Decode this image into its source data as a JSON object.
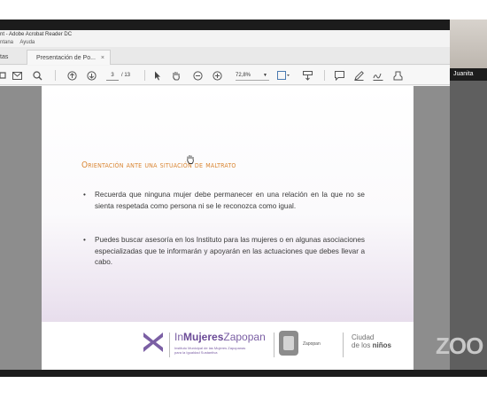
{
  "window": {
    "title": "nt - Adobe Acrobat Reader DC",
    "menu": [
      "ntana",
      "Ayuda"
    ]
  },
  "tabs": [
    {
      "label": "tas"
    },
    {
      "label": "Presentación de Po...",
      "close": "×"
    }
  ],
  "toolbar": {
    "page_current": "3",
    "page_total": "/ 13",
    "zoom": "72,8%"
  },
  "slide": {
    "heading": "Orientación ante una situación de maltrato",
    "bullets": [
      "Recuerda que ninguna mujer debe permanecer en una relación en la que no se sienta respetada como persona ni se le reconozca como igual.",
      "Puedes buscar asesoría en los Instituto para las mujeres o en algunas asociaciones especializadas que te informarán y apoyarán en las actuaciones que debes llevar a cabo."
    ],
    "footer": {
      "brand_prefix": "In",
      "brand_bold": "Mujeres",
      "brand_suffix": "Zapopan",
      "brand_sub1": "Instituto Municipal de las Mujeres Zapopanas",
      "brand_sub2": "para la Igualdad Sustantiva",
      "zapopan": "Zapopan",
      "ciudad_line1": "Ciudad",
      "ciudad_prefix": "de los ",
      "ciudad_bold": "niños"
    }
  },
  "participant": {
    "name": "Juanita"
  },
  "watermark": "ZOO",
  "colors": {
    "heading": "#d98531",
    "brand_purple": "#7b5fa4",
    "viewer_bg": "#8d8d8d"
  }
}
